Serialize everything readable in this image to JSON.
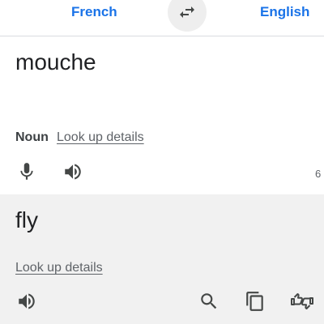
{
  "colors": {
    "accent": "#1a73e8",
    "icon": "#444746",
    "target_bg": "#f1f1f1"
  },
  "languages": {
    "source": "French",
    "target": "English",
    "swap_icon": "swap-horiz-icon"
  },
  "source": {
    "text": "mouche",
    "part_of_speech": "Noun",
    "lookup_label": "Look up details",
    "char_count": "6",
    "icons": [
      "microphone-icon",
      "speaker-icon"
    ]
  },
  "target": {
    "text": "fly",
    "lookup_label": "Look up details",
    "icons": [
      "speaker-icon",
      "search-icon",
      "copy-icon",
      "thumbs-feedback-icon"
    ]
  }
}
